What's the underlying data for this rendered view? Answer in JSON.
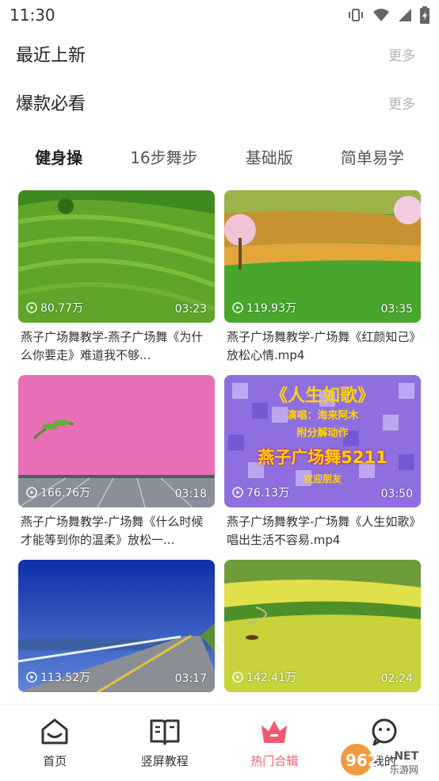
{
  "status": {
    "time": "11:30"
  },
  "sections": [
    {
      "title": "最近上新",
      "more": "更多"
    },
    {
      "title": "爆款必看",
      "more": "更多"
    }
  ],
  "tabs": [
    "健身操",
    "16步舞步",
    "基础版",
    "简单易学"
  ],
  "videos": [
    {
      "views": "80.77万",
      "duration": "03:23",
      "title": "燕子广场舞教学-燕子广场舞《为什么你要走》难道我不够..."
    },
    {
      "views": "119.93万",
      "duration": "03:35",
      "title": "燕子广场舞教学-广场舞《红颜知己》放松心情.mp4"
    },
    {
      "views": "166.76万",
      "duration": "03:18",
      "title": "燕子广场舞教学-广场舞《什么时候才能等到你的温柔》放松一..."
    },
    {
      "views": "76.13万",
      "duration": "03:50",
      "title": "燕子广场舞教学-广场舞《人生如歌》唱出生活不容易.mp4",
      "overlay": [
        "《人生如歌》",
        "演唱：海来阿木",
        "附分解动作",
        "燕子广场舞5211",
        "欢迎朋友"
      ]
    },
    {
      "views": "113.52万",
      "duration": "03:17",
      "title": ""
    },
    {
      "views": "142.41万",
      "duration": "02:24",
      "title": ""
    }
  ],
  "nav": [
    {
      "label": "首页",
      "icon": "home-icon"
    },
    {
      "label": "竖屏教程",
      "icon": "book-icon"
    },
    {
      "label": "热门合辑",
      "icon": "crown-icon",
      "active": true
    },
    {
      "label": "我的",
      "icon": "smile-icon"
    }
  ],
  "watermark": "962.NET 乐游网",
  "colors": {
    "accent": "#ef5a72"
  }
}
